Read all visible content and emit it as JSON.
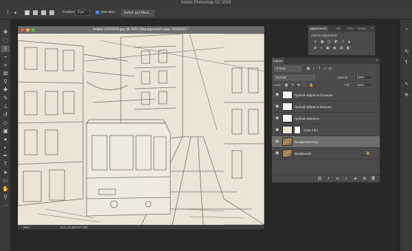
{
  "app": {
    "title": "Adobe Photoshop CC 2018"
  },
  "options_bar": {
    "feather_label": "Feather:",
    "feather_value": "0 px",
    "antialias_label": "Anti-alias",
    "select_mask_label": "Select and Mask..."
  },
  "toolbar": {
    "tools": [
      "move",
      "artboard",
      "lasso",
      "quick-selection",
      "crop",
      "frame",
      "eyedropper",
      "spot-healing",
      "brush",
      "clone-stamp",
      "history-brush",
      "eraser",
      "gradient",
      "blur",
      "dodge",
      "pen",
      "type",
      "path-selection",
      "rectangle",
      "hand",
      "zoom",
      "more"
    ],
    "active_tool": "lasso"
  },
  "document": {
    "title": "trolley-2203329.jpg @ 50% (Background copy, RGB/8#) *",
    "zoom": "50%",
    "doc_size": "Doc: 23,8M/107,0M"
  },
  "adjustments": {
    "tabs": [
      "Adjustments",
      "Libr",
      "Actio",
      "Chara"
    ],
    "add_label": "Add an adjustment"
  },
  "layers_panel": {
    "tab": "Layers",
    "filter_label": "Kind",
    "blend_mode": "Normal",
    "opacity_label": "Opacity:",
    "opacity_value": "100%",
    "lock_label": "Lock:",
    "fill_label": "Fill:",
    "fill_value": "100%",
    "layers": [
      {
        "name": "Грубый набросок большие",
        "type": "sketch",
        "selected": false
      },
      {
        "name": "Грубый набросок меньше",
        "type": "sketch",
        "selected": false
      },
      {
        "name": "Грубый набросок",
        "type": "sketch",
        "selected": false
      },
      {
        "name": "Color Fill 1",
        "type": "fill",
        "selected": false
      },
      {
        "name": "Background copy",
        "type": "photo",
        "selected": true
      },
      {
        "name": "Background",
        "type": "photo",
        "selected": false
      }
    ]
  },
  "colors": {
    "accent": "#3d7fe0",
    "panel_bg": "#4b4b4b",
    "app_bg": "#282828",
    "canvas_paper": "#e9e3d6"
  }
}
